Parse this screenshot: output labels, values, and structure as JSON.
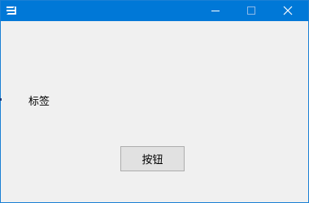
{
  "titlebar": {
    "title": "",
    "accent_color": "#0078d7",
    "app_icon": "app-logo-icon",
    "controls": {
      "minimize": "minimize-icon",
      "maximize": "maximize-icon",
      "close": "close-icon"
    }
  },
  "form": {
    "label_text": "标签",
    "button_label": "按钮",
    "background_color": "#f0f0f0"
  }
}
